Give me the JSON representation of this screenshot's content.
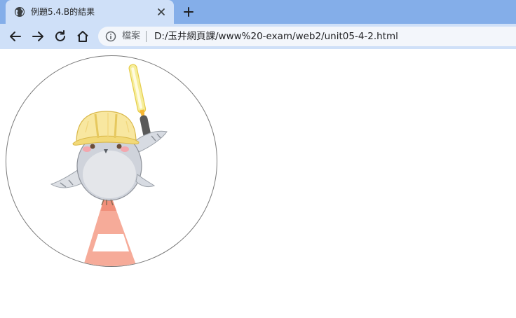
{
  "browser": {
    "tab": {
      "title": "例題5.4.B的結果",
      "favicon": "globe-icon",
      "close_icon": "close-icon"
    },
    "new_tab_icon": "plus-icon",
    "nav": {
      "back_icon": "arrow-left-icon",
      "forward_icon": "arrow-right-icon",
      "reload_icon": "reload-icon",
      "home_icon": "home-icon"
    },
    "address": {
      "info_icon": "info-icon",
      "security_label": "檔案",
      "url": "D:/玉井網頁課/www%20-exam/web2/unit05-4-2.html"
    }
  },
  "page": {
    "image": {
      "shape": "circle",
      "subject": "bird-with-hard-hat-and-traffic-cone"
    }
  },
  "colors": {
    "tabbar_bg": "#84aee9",
    "toolbar_bg": "#cfe0f8",
    "page_bg": "#ffffff"
  }
}
